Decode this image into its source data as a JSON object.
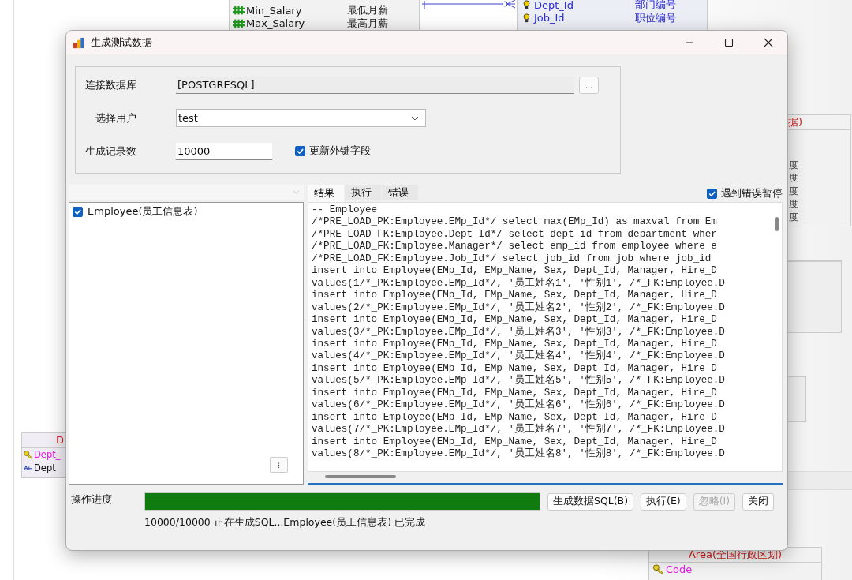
{
  "background_tables": [
    {
      "rows": [
        {
          "kind": "column",
          "name": "Min_Salary",
          "comment": "最低月薪"
        },
        {
          "kind": "column",
          "name": "Max_Salary",
          "comment": "最高月薪"
        }
      ]
    },
    {
      "rows": [
        {
          "kind": "fk",
          "name": "Dept_Id",
          "comment": "部门编号"
        },
        {
          "kind": "fk",
          "name": "Job_Id",
          "comment": "职位编号"
        }
      ]
    },
    {
      "header": "据)",
      "rows": [
        {
          "kind": "plain",
          "name": "度"
        },
        {
          "kind": "plain",
          "name": "度"
        },
        {
          "kind": "plain",
          "name": "度"
        },
        {
          "kind": "plain",
          "name": "度"
        },
        {
          "kind": "plain",
          "name": "度"
        }
      ]
    },
    {
      "header": "D",
      "rows": [
        {
          "kind": "key",
          "name": "Dept_"
        },
        {
          "kind": "text",
          "name": "Dept_"
        }
      ]
    },
    {
      "header": "Area(全国行政区划)",
      "rows": [
        {
          "kind": "key",
          "name": "Code"
        }
      ]
    }
  ],
  "dialog": {
    "title": "生成测试数据",
    "connection": {
      "label": "连接数据库",
      "value": "[POSTGRESQL]",
      "button": "..."
    },
    "user": {
      "label": "选择用户",
      "value": "test"
    },
    "record_count": {
      "label": "生成记录数",
      "value": "10000"
    },
    "update_fk": {
      "label": "更新外键字段",
      "checked": true
    },
    "table_list": [
      {
        "label": "Employee(员工信息表)",
        "checked": true
      }
    ],
    "tabs": [
      {
        "label": "结果",
        "selected": true
      },
      {
        "label": "执行",
        "selected": false
      },
      {
        "label": "错误",
        "selected": false
      }
    ],
    "stop_on_error": {
      "label": "遇到错误暂停",
      "checked": true
    },
    "sql_lines": [
      "-- Employee",
      "/*PRE_LOAD_PK:Employee.EMp_Id*/ select max(EMp_Id) as maxval from Em",
      "/*PRE_LOAD_FK:Employee.Dept_Id*/ select dept_id from department wher",
      "/*PRE_LOAD_FK:Employee.Manager*/ select emp_id from employee where e",
      "/*PRE_LOAD_FK:Employee.Job_Id*/ select job_id from job where job_id",
      "insert into Employee(EMp_Id, EMp_Name, Sex, Dept_Id, Manager, Hire_D",
      "values(1/*_PK:Employee.EMp_Id*/, '员工姓名1', '性别1', /*_FK:Employee.D",
      "insert into Employee(EMp_Id, EMp_Name, Sex, Dept_Id, Manager, Hire_D",
      "values(2/*_PK:Employee.EMp_Id*/, '员工姓名2', '性别2', /*_FK:Employee.D",
      "insert into Employee(EMp_Id, EMp_Name, Sex, Dept_Id, Manager, Hire_D",
      "values(3/*_PK:Employee.EMp_Id*/, '员工姓名3', '性别3', /*_FK:Employee.D",
      "insert into Employee(EMp_Id, EMp_Name, Sex, Dept_Id, Manager, Hire_D",
      "values(4/*_PK:Employee.EMp_Id*/, '员工姓名4', '性别4', /*_FK:Employee.D",
      "insert into Employee(EMp_Id, EMp_Name, Sex, Dept_Id, Manager, Hire_D",
      "values(5/*_PK:Employee.EMp_Id*/, '员工姓名5', '性别5', /*_FK:Employee.D",
      "insert into Employee(EMp_Id, EMp_Name, Sex, Dept_Id, Manager, Hire_D",
      "values(6/*_PK:Employee.EMp_Id*/, '员工姓名6', '性别6', /*_FK:Employee.D",
      "insert into Employee(EMp_Id, EMp_Name, Sex, Dept_Id, Manager, Hire_D",
      "values(7/*_PK:Employee.EMp_Id*/, '员工姓名7', '性别7', /*_FK:Employee.D",
      "insert into Employee(EMp_Id, EMp_Name, Sex, Dept_Id, Manager, Hire_D",
      "values(8/*_PK:Employee.EMp_Id*/, '员工姓名8', '性别8', /*_FK:Employee.D"
    ],
    "progress": {
      "label": "操作进度",
      "level": 1
    },
    "status": "10000/10000 正在生成SQL...Employee(员工信息表) 已完成",
    "buttons": [
      {
        "label": "生成数据SQL(B)",
        "disabled": false
      },
      {
        "label": "执行(E)",
        "disabled": false
      },
      {
        "label": "忽略(I)",
        "disabled": true
      },
      {
        "label": "关闭",
        "disabled": false
      }
    ]
  }
}
